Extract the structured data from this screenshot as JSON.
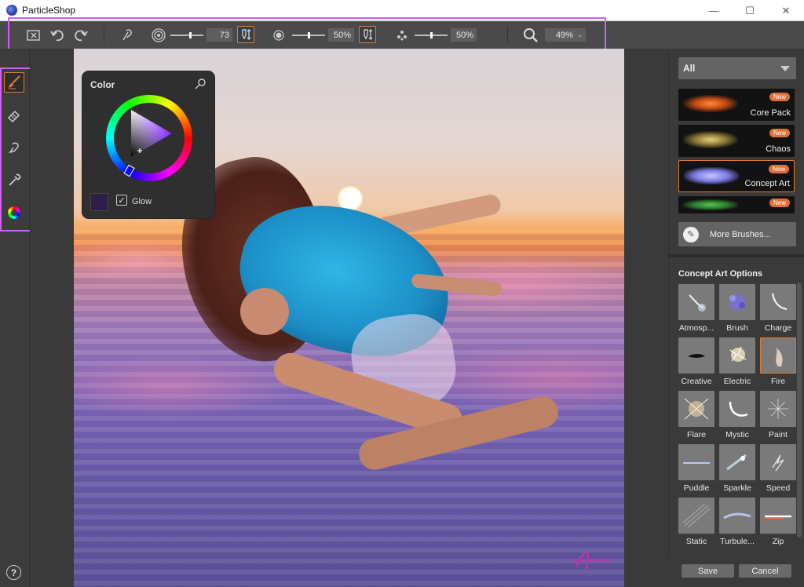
{
  "window": {
    "title": "ParticleShop",
    "minimize": "—",
    "maximize": "☐",
    "close": "✕"
  },
  "toolbar": {
    "brush_size_value": "73",
    "opacity_value": "50%",
    "density_value": "50%",
    "zoom_value": "49%",
    "zoom_caret": "⌄"
  },
  "color_panel": {
    "title": "Color",
    "glow_label": "Glow",
    "glow_checked": true,
    "current_color": "#2d1f4a"
  },
  "right_panel": {
    "category": "All",
    "packs": [
      {
        "name": "Core Pack",
        "badge": "New"
      },
      {
        "name": "Chaos",
        "badge": "New"
      },
      {
        "name": "Concept Art",
        "badge": "New",
        "active": true
      },
      {
        "name": "",
        "badge": "New"
      }
    ],
    "more_brushes": "More Brushes...",
    "options_title": "Concept Art Options",
    "brushes": [
      {
        "name": "Atmosp..."
      },
      {
        "name": "Brush"
      },
      {
        "name": "Charge"
      },
      {
        "name": "Creative"
      },
      {
        "name": "Electric"
      },
      {
        "name": "Fire",
        "active": true
      },
      {
        "name": "Flare"
      },
      {
        "name": "Mystic"
      },
      {
        "name": "Paint"
      },
      {
        "name": "Puddle"
      },
      {
        "name": "Sparkle"
      },
      {
        "name": "Speed"
      },
      {
        "name": "Static"
      },
      {
        "name": "Turbule..."
      },
      {
        "name": "Zip"
      }
    ],
    "save": "Save",
    "cancel": "Cancel"
  },
  "left_tools": {
    "help": "?"
  },
  "colors": {
    "accent": "#e07a2b",
    "highlight_frame": "#d15cff"
  }
}
